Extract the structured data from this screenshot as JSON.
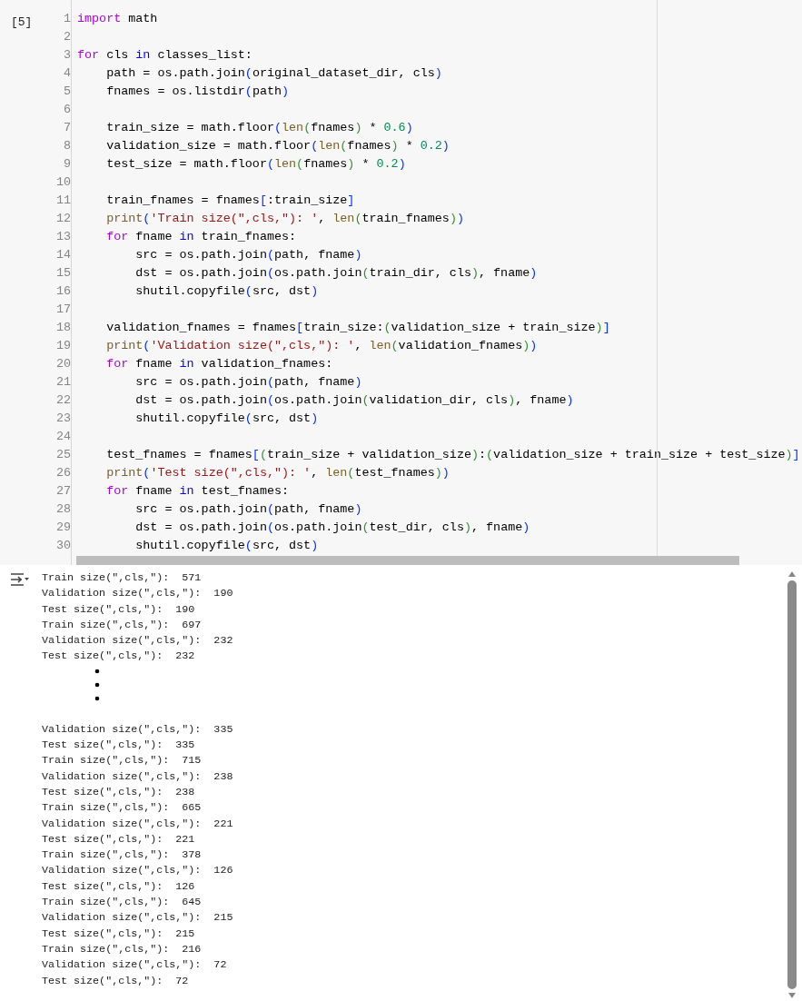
{
  "cell": {
    "execution_count": "[5]",
    "code_lines": [
      {
        "number": "1",
        "tokens": [
          {
            "kind": "keyword",
            "text": "import"
          },
          {
            "kind": "plain",
            "text": " math"
          }
        ]
      },
      {
        "number": "2"
      },
      {
        "number": "3",
        "tokens": [
          {
            "kind": "keyword",
            "text": "for"
          },
          {
            "kind": "plain",
            "text": " cls "
          },
          {
            "kind": "operator",
            "text": "in"
          },
          {
            "kind": "plain",
            "text": " classes_list:"
          }
        ]
      },
      {
        "number": "4",
        "tokens": [
          {
            "kind": "plain",
            "text": "    path = os.path.join"
          },
          {
            "kind": "bracket1",
            "text": "("
          },
          {
            "kind": "plain",
            "text": "original_dataset_dir, cls"
          },
          {
            "kind": "bracket1",
            "text": ")"
          }
        ]
      },
      {
        "number": "5",
        "tokens": [
          {
            "kind": "plain",
            "text": "    fnames = os.listdir"
          },
          {
            "kind": "bracket1",
            "text": "("
          },
          {
            "kind": "plain",
            "text": "path"
          },
          {
            "kind": "bracket1",
            "text": ")"
          }
        ]
      },
      {
        "number": "6"
      },
      {
        "number": "7",
        "tokens": [
          {
            "kind": "plain",
            "text": "    train_size = math.floor"
          },
          {
            "kind": "bracket1",
            "text": "("
          },
          {
            "kind": "function",
            "text": "len"
          },
          {
            "kind": "bracket2",
            "text": "("
          },
          {
            "kind": "plain",
            "text": "fnames"
          },
          {
            "kind": "bracket2",
            "text": ")"
          },
          {
            "kind": "plain",
            "text": " * "
          },
          {
            "kind": "number",
            "text": "0.6"
          },
          {
            "kind": "bracket1",
            "text": ")"
          }
        ]
      },
      {
        "number": "8",
        "tokens": [
          {
            "kind": "plain",
            "text": "    validation_size = math.floor"
          },
          {
            "kind": "bracket1",
            "text": "("
          },
          {
            "kind": "function",
            "text": "len"
          },
          {
            "kind": "bracket2",
            "text": "("
          },
          {
            "kind": "plain",
            "text": "fnames"
          },
          {
            "kind": "bracket2",
            "text": ")"
          },
          {
            "kind": "plain",
            "text": " * "
          },
          {
            "kind": "number",
            "text": "0.2"
          },
          {
            "kind": "bracket1",
            "text": ")"
          }
        ]
      },
      {
        "number": "9",
        "tokens": [
          {
            "kind": "plain",
            "text": "    test_size = math.floor"
          },
          {
            "kind": "bracket1",
            "text": "("
          },
          {
            "kind": "function",
            "text": "len"
          },
          {
            "kind": "bracket2",
            "text": "("
          },
          {
            "kind": "plain",
            "text": "fnames"
          },
          {
            "kind": "bracket2",
            "text": ")"
          },
          {
            "kind": "plain",
            "text": " * "
          },
          {
            "kind": "number",
            "text": "0.2"
          },
          {
            "kind": "bracket1",
            "text": ")"
          }
        ]
      },
      {
        "number": "10"
      },
      {
        "number": "11",
        "tokens": [
          {
            "kind": "plain",
            "text": "    train_fnames = fnames"
          },
          {
            "kind": "bracket1",
            "text": "["
          },
          {
            "kind": "plain",
            "text": ":train_size"
          },
          {
            "kind": "bracket1",
            "text": "]"
          }
        ]
      },
      {
        "number": "12",
        "tokens": [
          {
            "kind": "function",
            "text": "    print"
          },
          {
            "kind": "bracket1",
            "text": "("
          },
          {
            "kind": "string",
            "text": "'Train size(\",cls,\"): '"
          },
          {
            "kind": "plain",
            "text": ", "
          },
          {
            "kind": "function",
            "text": "len"
          },
          {
            "kind": "bracket2",
            "text": "("
          },
          {
            "kind": "plain",
            "text": "train_fnames"
          },
          {
            "kind": "bracket2",
            "text": ")"
          },
          {
            "kind": "bracket1",
            "text": ")"
          }
        ]
      },
      {
        "number": "13",
        "tokens": [
          {
            "kind": "keyword",
            "text": "    for"
          },
          {
            "kind": "plain",
            "text": " fname "
          },
          {
            "kind": "operator",
            "text": "in"
          },
          {
            "kind": "plain",
            "text": " train_fnames:"
          }
        ]
      },
      {
        "number": "14",
        "tokens": [
          {
            "kind": "plain",
            "text": "        src = os.path.join"
          },
          {
            "kind": "bracket1",
            "text": "("
          },
          {
            "kind": "plain",
            "text": "path, fname"
          },
          {
            "kind": "bracket1",
            "text": ")"
          }
        ]
      },
      {
        "number": "15",
        "tokens": [
          {
            "kind": "plain",
            "text": "        dst = os.path.join"
          },
          {
            "kind": "bracket1",
            "text": "("
          },
          {
            "kind": "plain",
            "text": "os.path.join"
          },
          {
            "kind": "bracket2",
            "text": "("
          },
          {
            "kind": "plain",
            "text": "train_dir, cls"
          },
          {
            "kind": "bracket2",
            "text": ")"
          },
          {
            "kind": "plain",
            "text": ", fname"
          },
          {
            "kind": "bracket1",
            "text": ")"
          }
        ]
      },
      {
        "number": "16",
        "tokens": [
          {
            "kind": "plain",
            "text": "        shutil.copyfile"
          },
          {
            "kind": "bracket1",
            "text": "("
          },
          {
            "kind": "plain",
            "text": "src, dst"
          },
          {
            "kind": "bracket1",
            "text": ")"
          }
        ]
      },
      {
        "number": "17"
      },
      {
        "number": "18",
        "tokens": [
          {
            "kind": "plain",
            "text": "    validation_fnames = fnames"
          },
          {
            "kind": "bracket1",
            "text": "["
          },
          {
            "kind": "plain",
            "text": "train_size:"
          },
          {
            "kind": "bracket2",
            "text": "("
          },
          {
            "kind": "plain",
            "text": "validation_size + train_size"
          },
          {
            "kind": "bracket2",
            "text": ")"
          },
          {
            "kind": "bracket1",
            "text": "]"
          }
        ]
      },
      {
        "number": "19",
        "tokens": [
          {
            "kind": "function",
            "text": "    print"
          },
          {
            "kind": "bracket1",
            "text": "("
          },
          {
            "kind": "string",
            "text": "'Validation size(\",cls,\"): '"
          },
          {
            "kind": "plain",
            "text": ", "
          },
          {
            "kind": "function",
            "text": "len"
          },
          {
            "kind": "bracket2",
            "text": "("
          },
          {
            "kind": "plain",
            "text": "validation_fnames"
          },
          {
            "kind": "bracket2",
            "text": ")"
          },
          {
            "kind": "bracket1",
            "text": ")"
          }
        ]
      },
      {
        "number": "20",
        "tokens": [
          {
            "kind": "keyword",
            "text": "    for"
          },
          {
            "kind": "plain",
            "text": " fname "
          },
          {
            "kind": "operator",
            "text": "in"
          },
          {
            "kind": "plain",
            "text": " validation_fnames:"
          }
        ]
      },
      {
        "number": "21",
        "tokens": [
          {
            "kind": "plain",
            "text": "        src = os.path.join"
          },
          {
            "kind": "bracket1",
            "text": "("
          },
          {
            "kind": "plain",
            "text": "path, fname"
          },
          {
            "kind": "bracket1",
            "text": ")"
          }
        ]
      },
      {
        "number": "22",
        "tokens": [
          {
            "kind": "plain",
            "text": "        dst = os.path.join"
          },
          {
            "kind": "bracket1",
            "text": "("
          },
          {
            "kind": "plain",
            "text": "os.path.join"
          },
          {
            "kind": "bracket2",
            "text": "("
          },
          {
            "kind": "plain",
            "text": "validation_dir, cls"
          },
          {
            "kind": "bracket2",
            "text": ")"
          },
          {
            "kind": "plain",
            "text": ", fname"
          },
          {
            "kind": "bracket1",
            "text": ")"
          }
        ]
      },
      {
        "number": "23",
        "tokens": [
          {
            "kind": "plain",
            "text": "        shutil.copyfile"
          },
          {
            "kind": "bracket1",
            "text": "("
          },
          {
            "kind": "plain",
            "text": "src, dst"
          },
          {
            "kind": "bracket1",
            "text": ")"
          }
        ]
      },
      {
        "number": "24"
      },
      {
        "number": "25",
        "tokens": [
          {
            "kind": "plain",
            "text": "    test_fnames = fnames"
          },
          {
            "kind": "bracket1",
            "text": "["
          },
          {
            "kind": "bracket2",
            "text": "("
          },
          {
            "kind": "plain",
            "text": "train_size + validation_size"
          },
          {
            "kind": "bracket2",
            "text": ")"
          },
          {
            "kind": "plain",
            "text": ":"
          },
          {
            "kind": "bracket2",
            "text": "("
          },
          {
            "kind": "plain",
            "text": "validation_size + train_size + test_size"
          },
          {
            "kind": "bracket2",
            "text": ")"
          },
          {
            "kind": "bracket1",
            "text": "]"
          }
        ]
      },
      {
        "number": "26",
        "tokens": [
          {
            "kind": "function",
            "text": "    print"
          },
          {
            "kind": "bracket1",
            "text": "("
          },
          {
            "kind": "string",
            "text": "'Test size(\",cls,\"): '"
          },
          {
            "kind": "plain",
            "text": ", "
          },
          {
            "kind": "function",
            "text": "len"
          },
          {
            "kind": "bracket2",
            "text": "("
          },
          {
            "kind": "plain",
            "text": "test_fnames"
          },
          {
            "kind": "bracket2",
            "text": ")"
          },
          {
            "kind": "bracket1",
            "text": ")"
          }
        ]
      },
      {
        "number": "27",
        "tokens": [
          {
            "kind": "keyword",
            "text": "    for"
          },
          {
            "kind": "plain",
            "text": " fname "
          },
          {
            "kind": "operator",
            "text": "in"
          },
          {
            "kind": "plain",
            "text": " test_fnames:"
          }
        ]
      },
      {
        "number": "28",
        "tokens": [
          {
            "kind": "plain",
            "text": "        src = os.path.join"
          },
          {
            "kind": "bracket1",
            "text": "("
          },
          {
            "kind": "plain",
            "text": "path, fname"
          },
          {
            "kind": "bracket1",
            "text": ")"
          }
        ]
      },
      {
        "number": "29",
        "tokens": [
          {
            "kind": "plain",
            "text": "        dst = os.path.join"
          },
          {
            "kind": "bracket1",
            "text": "("
          },
          {
            "kind": "plain",
            "text": "os.path.join"
          },
          {
            "kind": "bracket2",
            "text": "("
          },
          {
            "kind": "plain",
            "text": "test_dir, cls"
          },
          {
            "kind": "bracket2",
            "text": ")"
          },
          {
            "kind": "plain",
            "text": ", fname"
          },
          {
            "kind": "bracket1",
            "text": ")"
          }
        ]
      },
      {
        "number": "30",
        "tokens": [
          {
            "kind": "plain",
            "text": "        shutil.copyfile"
          },
          {
            "kind": "bracket1",
            "text": "("
          },
          {
            "kind": "plain",
            "text": "src, dst"
          },
          {
            "kind": "bracket1",
            "text": ")"
          }
        ]
      }
    ],
    "output": [
      {
        "kind": "line",
        "text": "Train size(\",cls,\"):  571"
      },
      {
        "kind": "line",
        "text": "Validation size(\",cls,\"):  190"
      },
      {
        "kind": "line",
        "text": "Test size(\",cls,\"):  190"
      },
      {
        "kind": "line",
        "text": "Train size(\",cls,\"):  697"
      },
      {
        "kind": "line",
        "text": "Validation size(\",cls,\"):  232"
      },
      {
        "kind": "line",
        "text": "Test size(\",cls,\"):  232"
      },
      {
        "kind": "vdots"
      },
      {
        "kind": "line",
        "text": "Validation size(\",cls,\"):  335"
      },
      {
        "kind": "line",
        "text": "Test size(\",cls,\"):  335"
      },
      {
        "kind": "line",
        "text": "Train size(\",cls,\"):  715"
      },
      {
        "kind": "line",
        "text": "Validation size(\",cls,\"):  238"
      },
      {
        "kind": "line",
        "text": "Test size(\",cls,\"):  238"
      },
      {
        "kind": "line",
        "text": "Train size(\",cls,\"):  665"
      },
      {
        "kind": "line",
        "text": "Validation size(\",cls,\"):  221"
      },
      {
        "kind": "line",
        "text": "Test size(\",cls,\"):  221"
      },
      {
        "kind": "line",
        "text": "Train size(\",cls,\"):  378"
      },
      {
        "kind": "line",
        "text": "Validation size(\",cls,\"):  126"
      },
      {
        "kind": "line",
        "text": "Test size(\",cls,\"):  126"
      },
      {
        "kind": "line",
        "text": "Train size(\",cls,\"):  645"
      },
      {
        "kind": "line",
        "text": "Validation size(\",cls,\"):  215"
      },
      {
        "kind": "line",
        "text": "Test size(\",cls,\"):  215"
      },
      {
        "kind": "line",
        "text": "Train size(\",cls,\"):  216"
      },
      {
        "kind": "line",
        "text": "Validation size(\",cls,\"):  72"
      },
      {
        "kind": "line",
        "text": "Test size(\",cls,\"):  72"
      }
    ]
  }
}
